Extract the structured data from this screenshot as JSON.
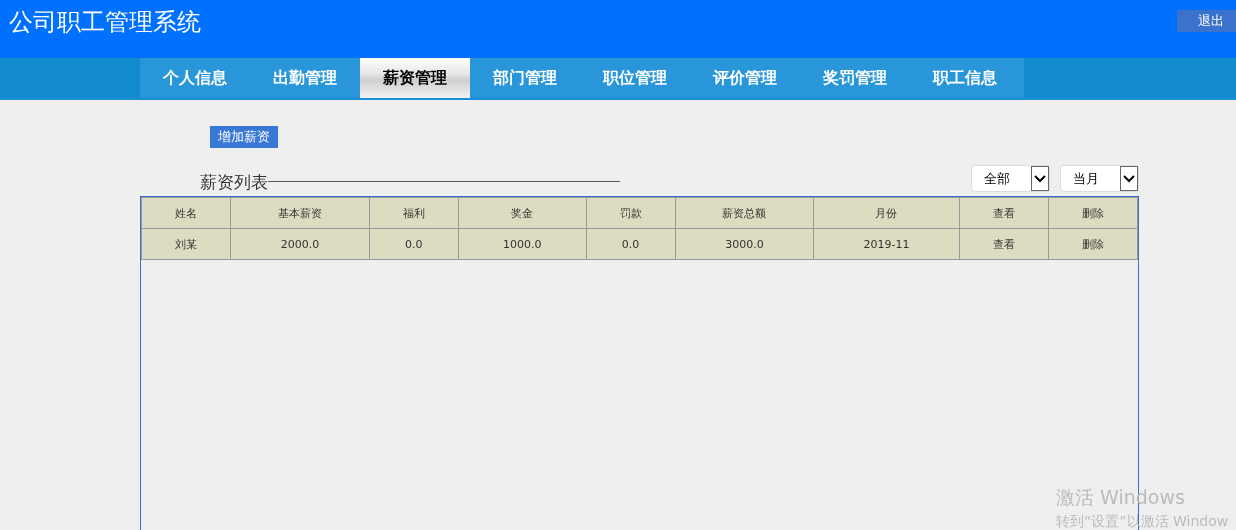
{
  "header": {
    "title": "公司职工管理系统",
    "logout_button": "退出"
  },
  "nav_tabs": [
    {
      "label": "个人信息",
      "selected": false
    },
    {
      "label": "出勤管理",
      "selected": false
    },
    {
      "label": "薪资管理",
      "selected": true
    },
    {
      "label": "部门管理",
      "selected": false
    },
    {
      "label": "职位管理",
      "selected": false
    },
    {
      "label": "评价管理",
      "selected": false
    },
    {
      "label": "奖罚管理",
      "selected": false
    },
    {
      "label": "职工信息",
      "selected": false
    }
  ],
  "add_button": "增加薪资",
  "list_title": "薪资列表",
  "filters": [
    {
      "value": "全部"
    },
    {
      "value": "当月"
    }
  ],
  "table": {
    "columns": [
      "姓名",
      "基本薪资",
      "福利",
      "奖金",
      "罚款",
      "薪资总额",
      "月份",
      "查看",
      "删除"
    ],
    "rows": [
      [
        "刘某",
        "2000.0",
        "0.0",
        "1000.0",
        "0.0",
        "3000.0",
        "2019-11",
        "查看",
        "删除"
      ]
    ]
  },
  "os_notice": {
    "title": "激活 Windows",
    "text": "转到“设置”以激活 Window"
  }
}
